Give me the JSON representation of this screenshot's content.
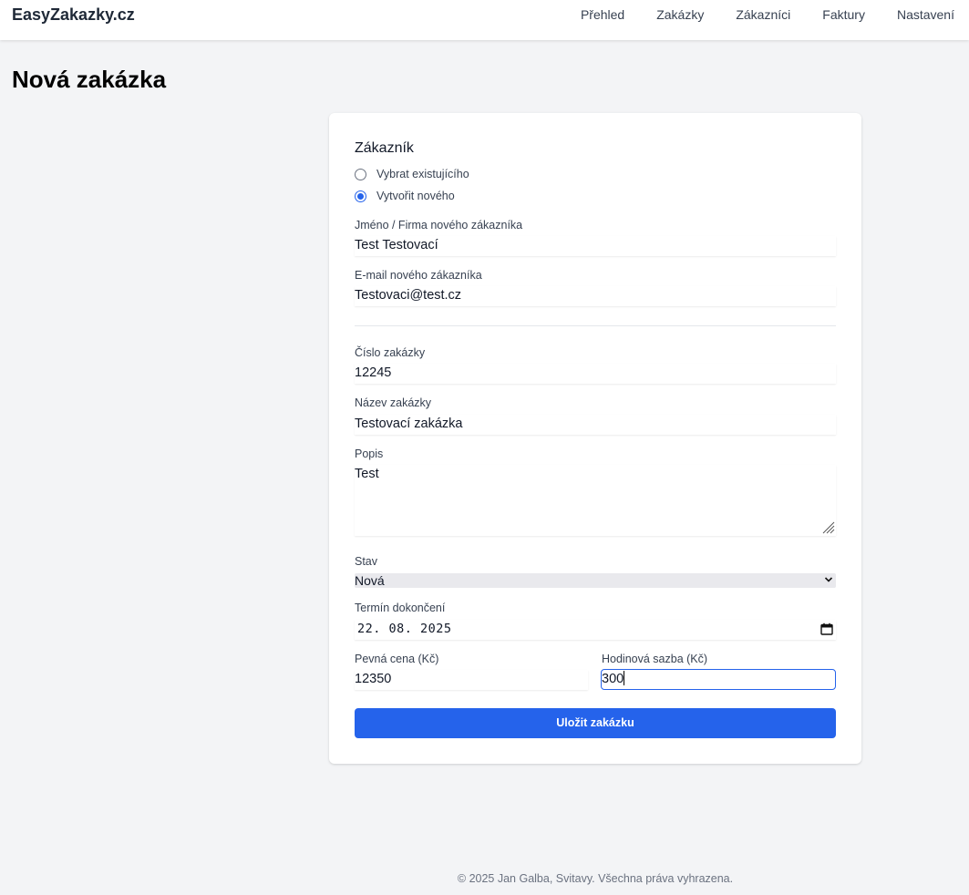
{
  "brand": "EasyZakazky.cz",
  "nav": [
    "Přehled",
    "Zakázky",
    "Zákazníci",
    "Faktury",
    "Nastavení"
  ],
  "page_title": "Nová zakázka",
  "customer": {
    "section_title": "Zákazník",
    "option_existing": "Vybrat existujícího",
    "option_new": "Vytvořit nového",
    "selected": "Vytvořit nového",
    "name_label": "Jméno / Firma nového zákazníka",
    "name_value": "Test Testovací",
    "email_label": "E-mail nového zákazníka",
    "email_value": "Testovaci@test.cz"
  },
  "order": {
    "number_label": "Číslo zakázky",
    "number_value": "12245",
    "name_label": "Název zakázky",
    "name_value": "Testovací zakázka",
    "description_label": "Popis",
    "description_value": "Test",
    "status_label": "Stav",
    "status_value": "Nová",
    "deadline_label": "Termín dokončení",
    "deadline_value": "22. 08. 2025",
    "fixed_price_label": "Pevná cena (Kč)",
    "fixed_price_value": "12350",
    "hourly_rate_label": "Hodinová sazba (Kč)",
    "hourly_rate_value": "300"
  },
  "submit_label": "Uložit zakázku",
  "footer": "© 2025 Jan Galba, Svitavy. Všechna práva vyhrazena.",
  "colors": {
    "accent": "#2563eb",
    "background": "#f3f4f6",
    "card": "#ffffff"
  }
}
